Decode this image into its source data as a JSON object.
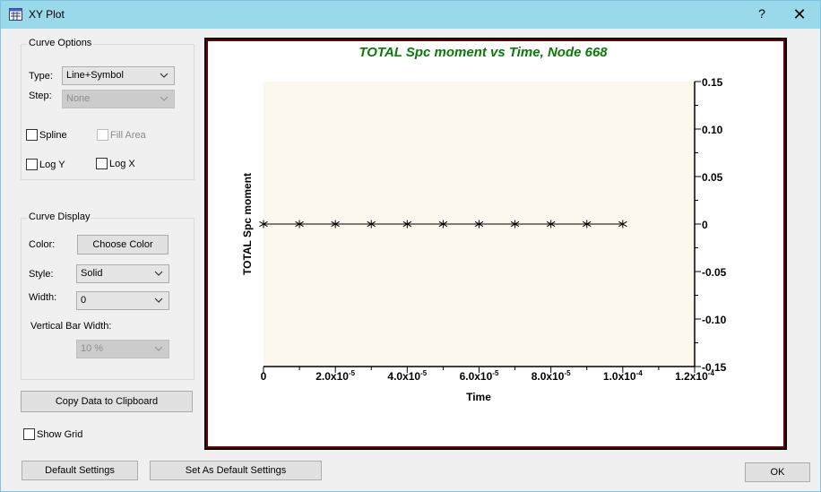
{
  "window": {
    "title": "XY Plot",
    "help_label": "?",
    "close_label": "✕",
    "icon": "xy-plot-app-icon"
  },
  "curve_options": {
    "title": "Curve Options",
    "type_label": "Type:",
    "type_value": "Line+Symbol",
    "step_label": "Step:",
    "step_value": "None",
    "spline_label": "Spline",
    "spline_checked": false,
    "fill_area_label": "Fill Area",
    "fill_area_checked": false,
    "log_y_label": "Log Y",
    "log_y_checked": false,
    "log_x_label": "Log X",
    "log_x_checked": false
  },
  "curve_display": {
    "title": "Curve Display",
    "color_label": "Color:",
    "choose_color_label": "Choose Color",
    "style_label": "Style:",
    "style_value": "Solid",
    "width_label": "Width:",
    "width_value": "0",
    "vbar_width_label": "Vertical Bar Width:",
    "vbar_width_value": "10 %"
  },
  "copy_button_label": "Copy Data to Clipboard",
  "show_grid_label": "Show Grid",
  "show_grid_checked": false,
  "default_settings_label": "Default Settings",
  "set_default_label": "Set As Default Settings",
  "ok_label": "OK",
  "chart_data": {
    "type": "line",
    "title": "TOTAL Spc moment  vs Time, Node 668",
    "xlabel": "Time",
    "ylabel": "TOTAL Spc moment",
    "xlim": [
      0,
      0.00012
    ],
    "ylim": [
      -0.15,
      0.15
    ],
    "x_ticks": [
      {
        "value": 0,
        "label": "0"
      },
      {
        "value": 2e-05,
        "label": "2.0x10",
        "exp": "-5"
      },
      {
        "value": 4e-05,
        "label": "4.0x10",
        "exp": "-5"
      },
      {
        "value": 6e-05,
        "label": "6.0x10",
        "exp": "-5"
      },
      {
        "value": 8e-05,
        "label": "8.0x10",
        "exp": "-5"
      },
      {
        "value": 0.0001,
        "label": "1.0x10",
        "exp": "-4"
      },
      {
        "value": 0.00012,
        "label": "1.2x10",
        "exp": "-4"
      }
    ],
    "y_ticks": [
      {
        "value": 0.15,
        "label": "0.15"
      },
      {
        "value": 0.1,
        "label": "0.10"
      },
      {
        "value": 0.05,
        "label": "0.05"
      },
      {
        "value": 0,
        "label": "0"
      },
      {
        "value": -0.05,
        "label": "-0.05"
      },
      {
        "value": -0.1,
        "label": "-0.10"
      },
      {
        "value": -0.15,
        "label": "-0.15"
      }
    ],
    "series": [
      {
        "x": [
          0,
          1e-05,
          2e-05,
          3e-05,
          4e-05,
          5e-05,
          6e-05,
          7e-05,
          8e-05,
          9e-05,
          0.0001
        ],
        "y": [
          0,
          0,
          0,
          0,
          0,
          0,
          0,
          0,
          0,
          0,
          0
        ],
        "marker": "asterisk"
      }
    ],
    "grid": false,
    "colors": {
      "title": "#0a7a0a",
      "plot_bg": "#fdf8ee",
      "line": "#000000"
    }
  }
}
